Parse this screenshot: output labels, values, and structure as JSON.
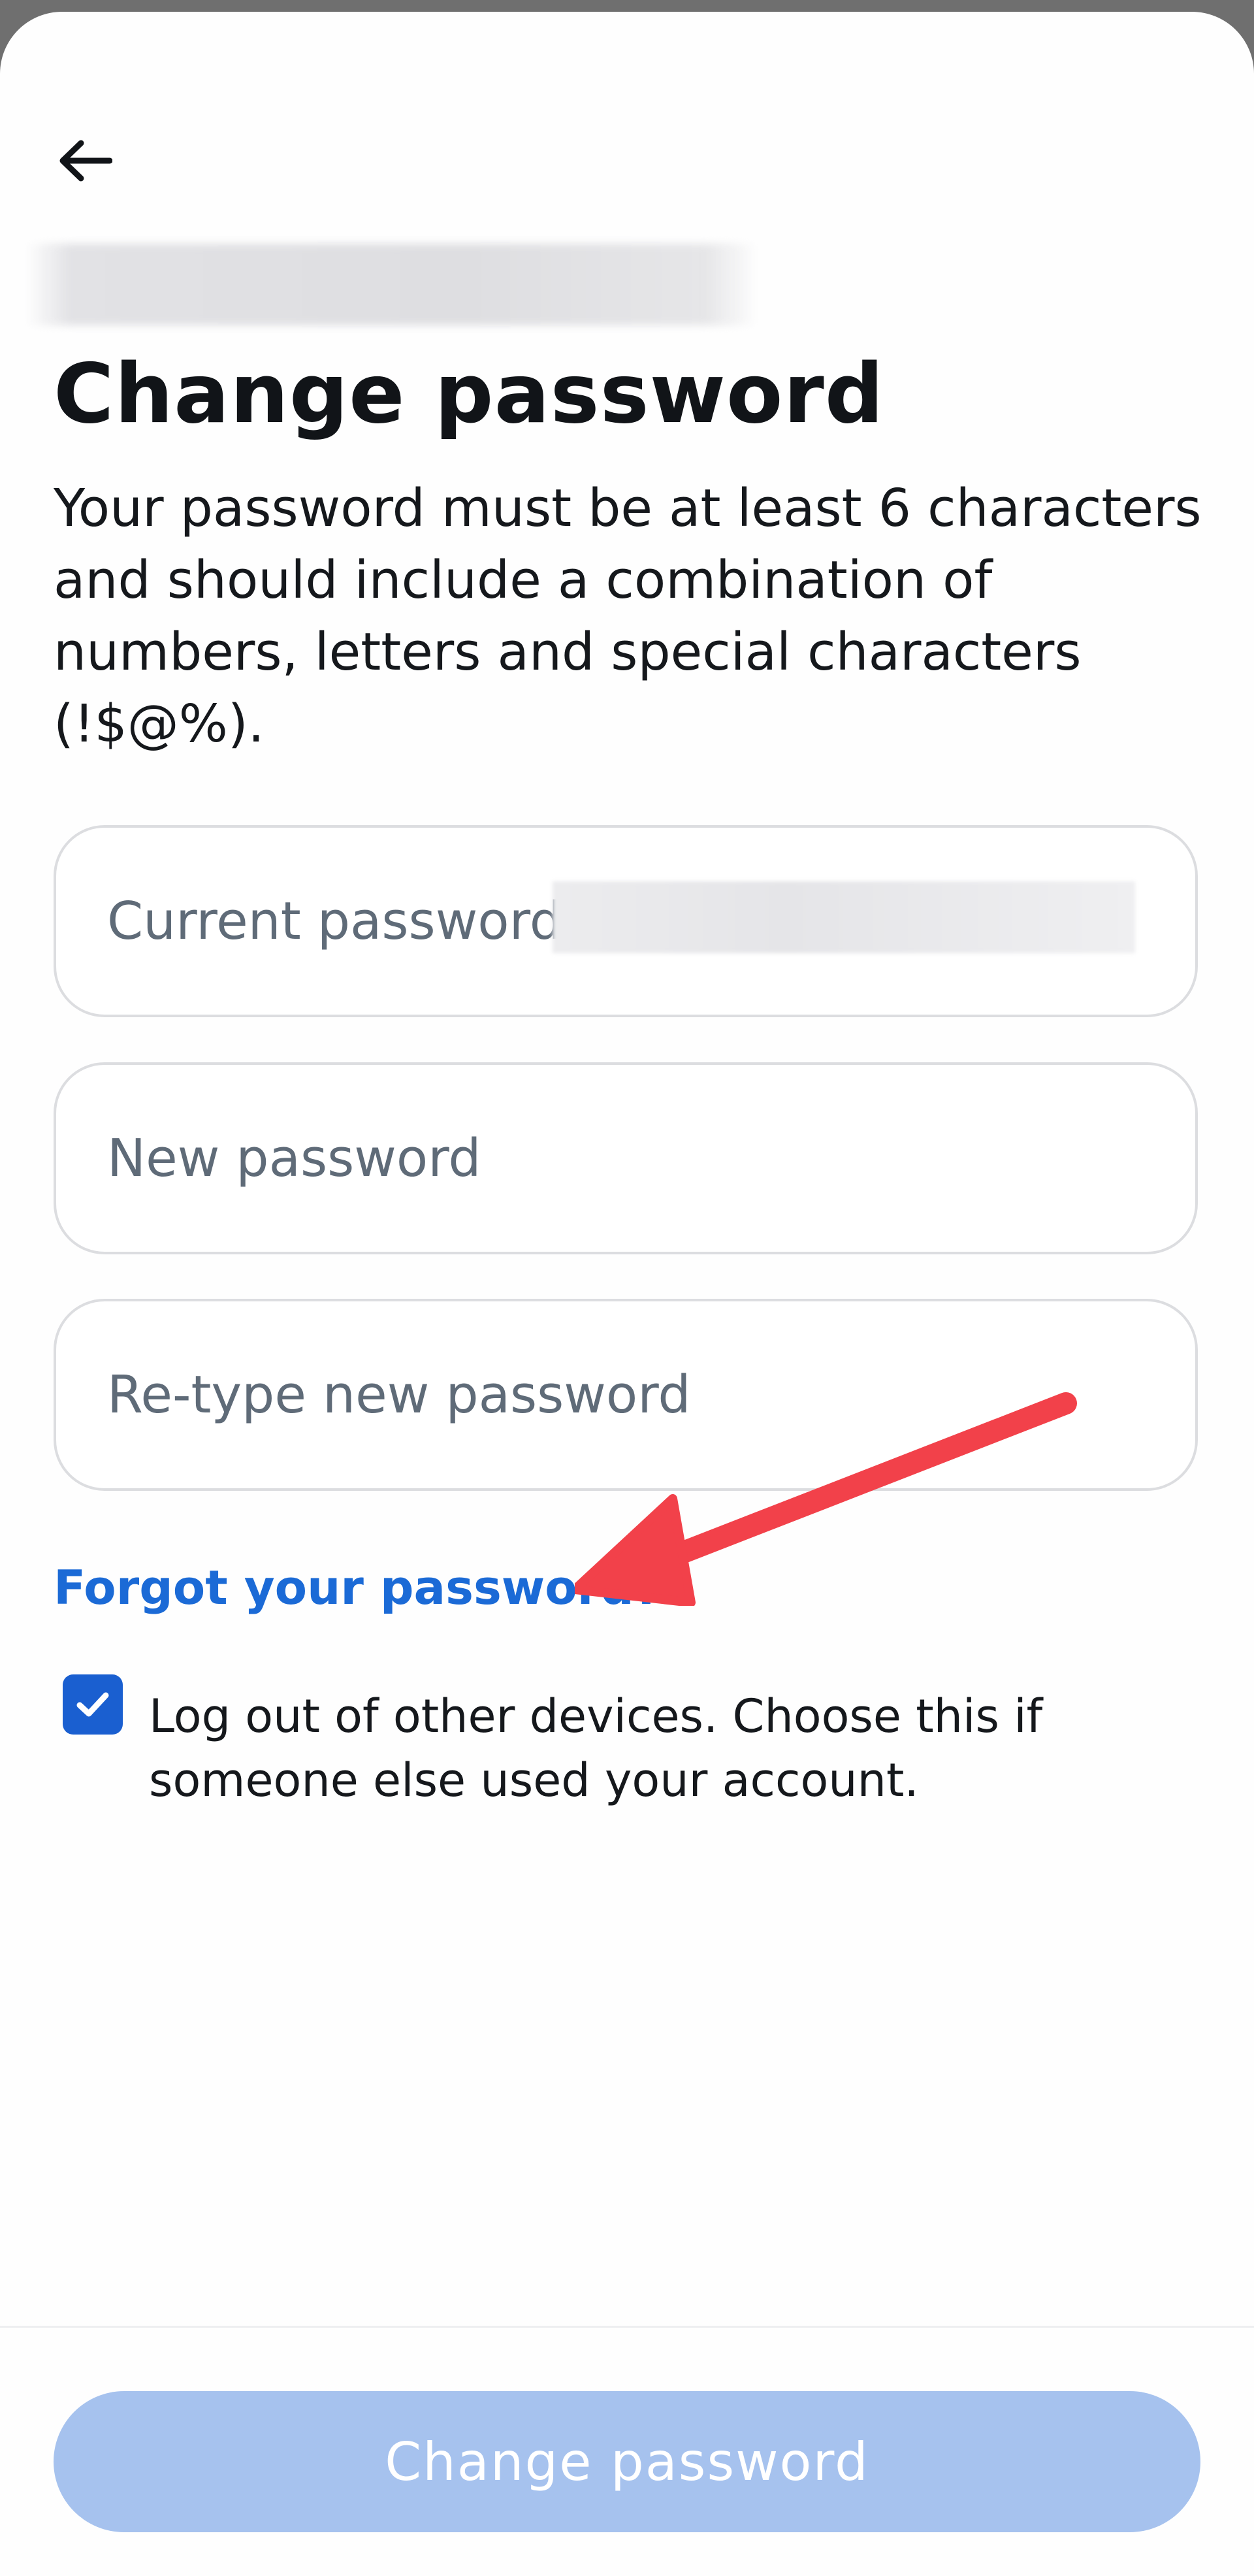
{
  "header": {
    "back_icon": "arrow-left-icon",
    "account_name": "",
    "title": "Change password"
  },
  "description": "Your password must be at least 6 characters and should include a combination of numbers, letters and special characters (!$@%).",
  "form": {
    "current_password": {
      "placeholder": "Current password",
      "value": ""
    },
    "new_password": {
      "placeholder": "New password",
      "value": ""
    },
    "retype_password": {
      "placeholder": "Re-type new password",
      "value": ""
    },
    "forgot_link": "Forgot your password?",
    "logout_others": {
      "checked": true,
      "label": "Log out of other devices. Choose this if someone else used your account."
    }
  },
  "annotation": {
    "arrow_color": "#f2414a",
    "icon": "red-arrow-pointer"
  },
  "footer": {
    "submit_label": "Change password"
  },
  "colors": {
    "link": "#1b6ad6",
    "checkbox": "#1a5fd0",
    "button_disabled": "#a6c2ee"
  }
}
